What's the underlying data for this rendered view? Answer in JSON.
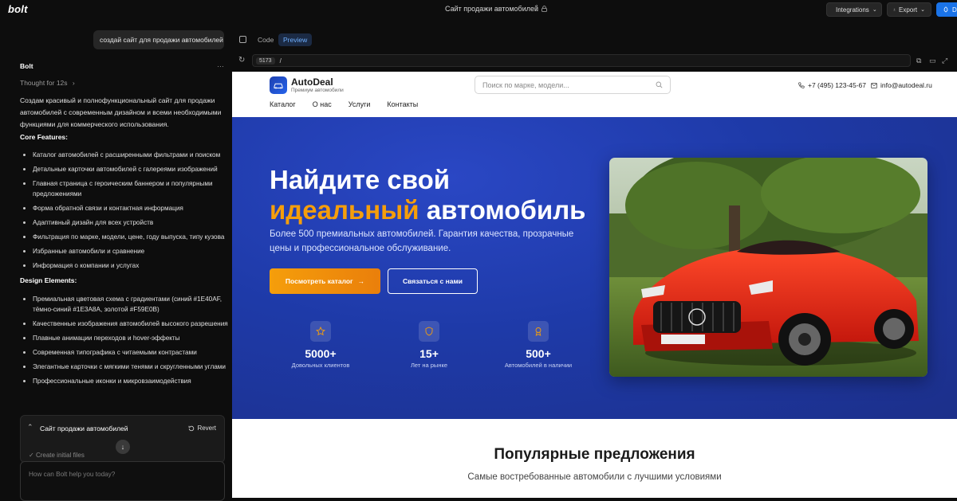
{
  "app": {
    "logo": "bolt",
    "project_title": "Сайт продажи автомобилей",
    "integrations_label": "Integrations",
    "export_label": "Export",
    "deploy_label": "De"
  },
  "chat": {
    "user_message": "создай сайт для продажи автомобилей",
    "assistant_name": "Bolt",
    "thought": "Thought for 12s",
    "intro": "Создам красивый и полнофункциональный сайт для продажи автомобилей с современным дизайном и всеми необходимыми функциями для коммерческого использования.",
    "core_heading": "Core Features:",
    "core_features": [
      "Каталог автомобилей с расширенными фильтрами и поиском",
      "Детальные карточки автомобилей с галереями изображений",
      "Главная страница с героическим баннером и популярными предложениями",
      "Форма обратной связи и контактная информация",
      "Адаптивный дизайн для всех устройств",
      "Фильтрация по марке, модели, цене, году выпуска, типу кузова",
      "Избранные автомобили и сравнение",
      "Информация о компании и услугах"
    ],
    "design_heading": "Design Elements:",
    "design_elements": [
      "Премиальная цветовая схема с градиентами (синий #1E40AF, тёмно-синий #1E3A8A, золотой #F59E0B)",
      "Качественные изображения автомобилей высокого разрешения",
      "Плавные анимации переходов и hover-эффекты",
      "Современная типографика с читаемыми контрастами",
      "Элегантные карточки с мягкими тенями и скругленными углами",
      "Профессиональные иконки и микровзаимодействия"
    ],
    "action_title": "Сайт продажи автомобилей",
    "revert_label": "Revert",
    "created_files": "Create initial files",
    "input_placeholder": "How can Bolt help you today?"
  },
  "preview": {
    "tab_code": "Code",
    "tab_preview": "Preview",
    "port": "5173",
    "path": "/"
  },
  "site": {
    "brand": "AutoDeal",
    "tagline": "Премиум автомобили",
    "search_placeholder": "Поиск по марке, модели...",
    "phone": "+7 (495) 123-45-67",
    "email": "info@autodeal.ru",
    "nav": [
      "Каталог",
      "О нас",
      "Услуги",
      "Контакты"
    ],
    "hero_line1": "Найдите свой",
    "hero_gold": "идеальный",
    "hero_line2_rest": "автомобиль",
    "hero_sub": "Более 500 премиальных автомобилей. Гарантия качества, прозрачные цены и профессиональное обслуживание.",
    "btn_catalog": "Посмотреть каталог",
    "btn_contact": "Связаться с нами",
    "stats": [
      {
        "num": "5000+",
        "label": "Довольных клиентов",
        "icon": "star-icon"
      },
      {
        "num": "15+",
        "label": "Лет на рынке",
        "icon": "shield-icon"
      },
      {
        "num": "500+",
        "label": "Автомобилей в наличии",
        "icon": "award-icon"
      }
    ],
    "popular_title": "Популярные предложения",
    "popular_sub": "Самые востребованные автомобили с лучшими условиями"
  },
  "colors": {
    "hero_blue": "#1E40AF",
    "gold": "#F59E0B",
    "deploy_blue": "#1a73e8"
  }
}
